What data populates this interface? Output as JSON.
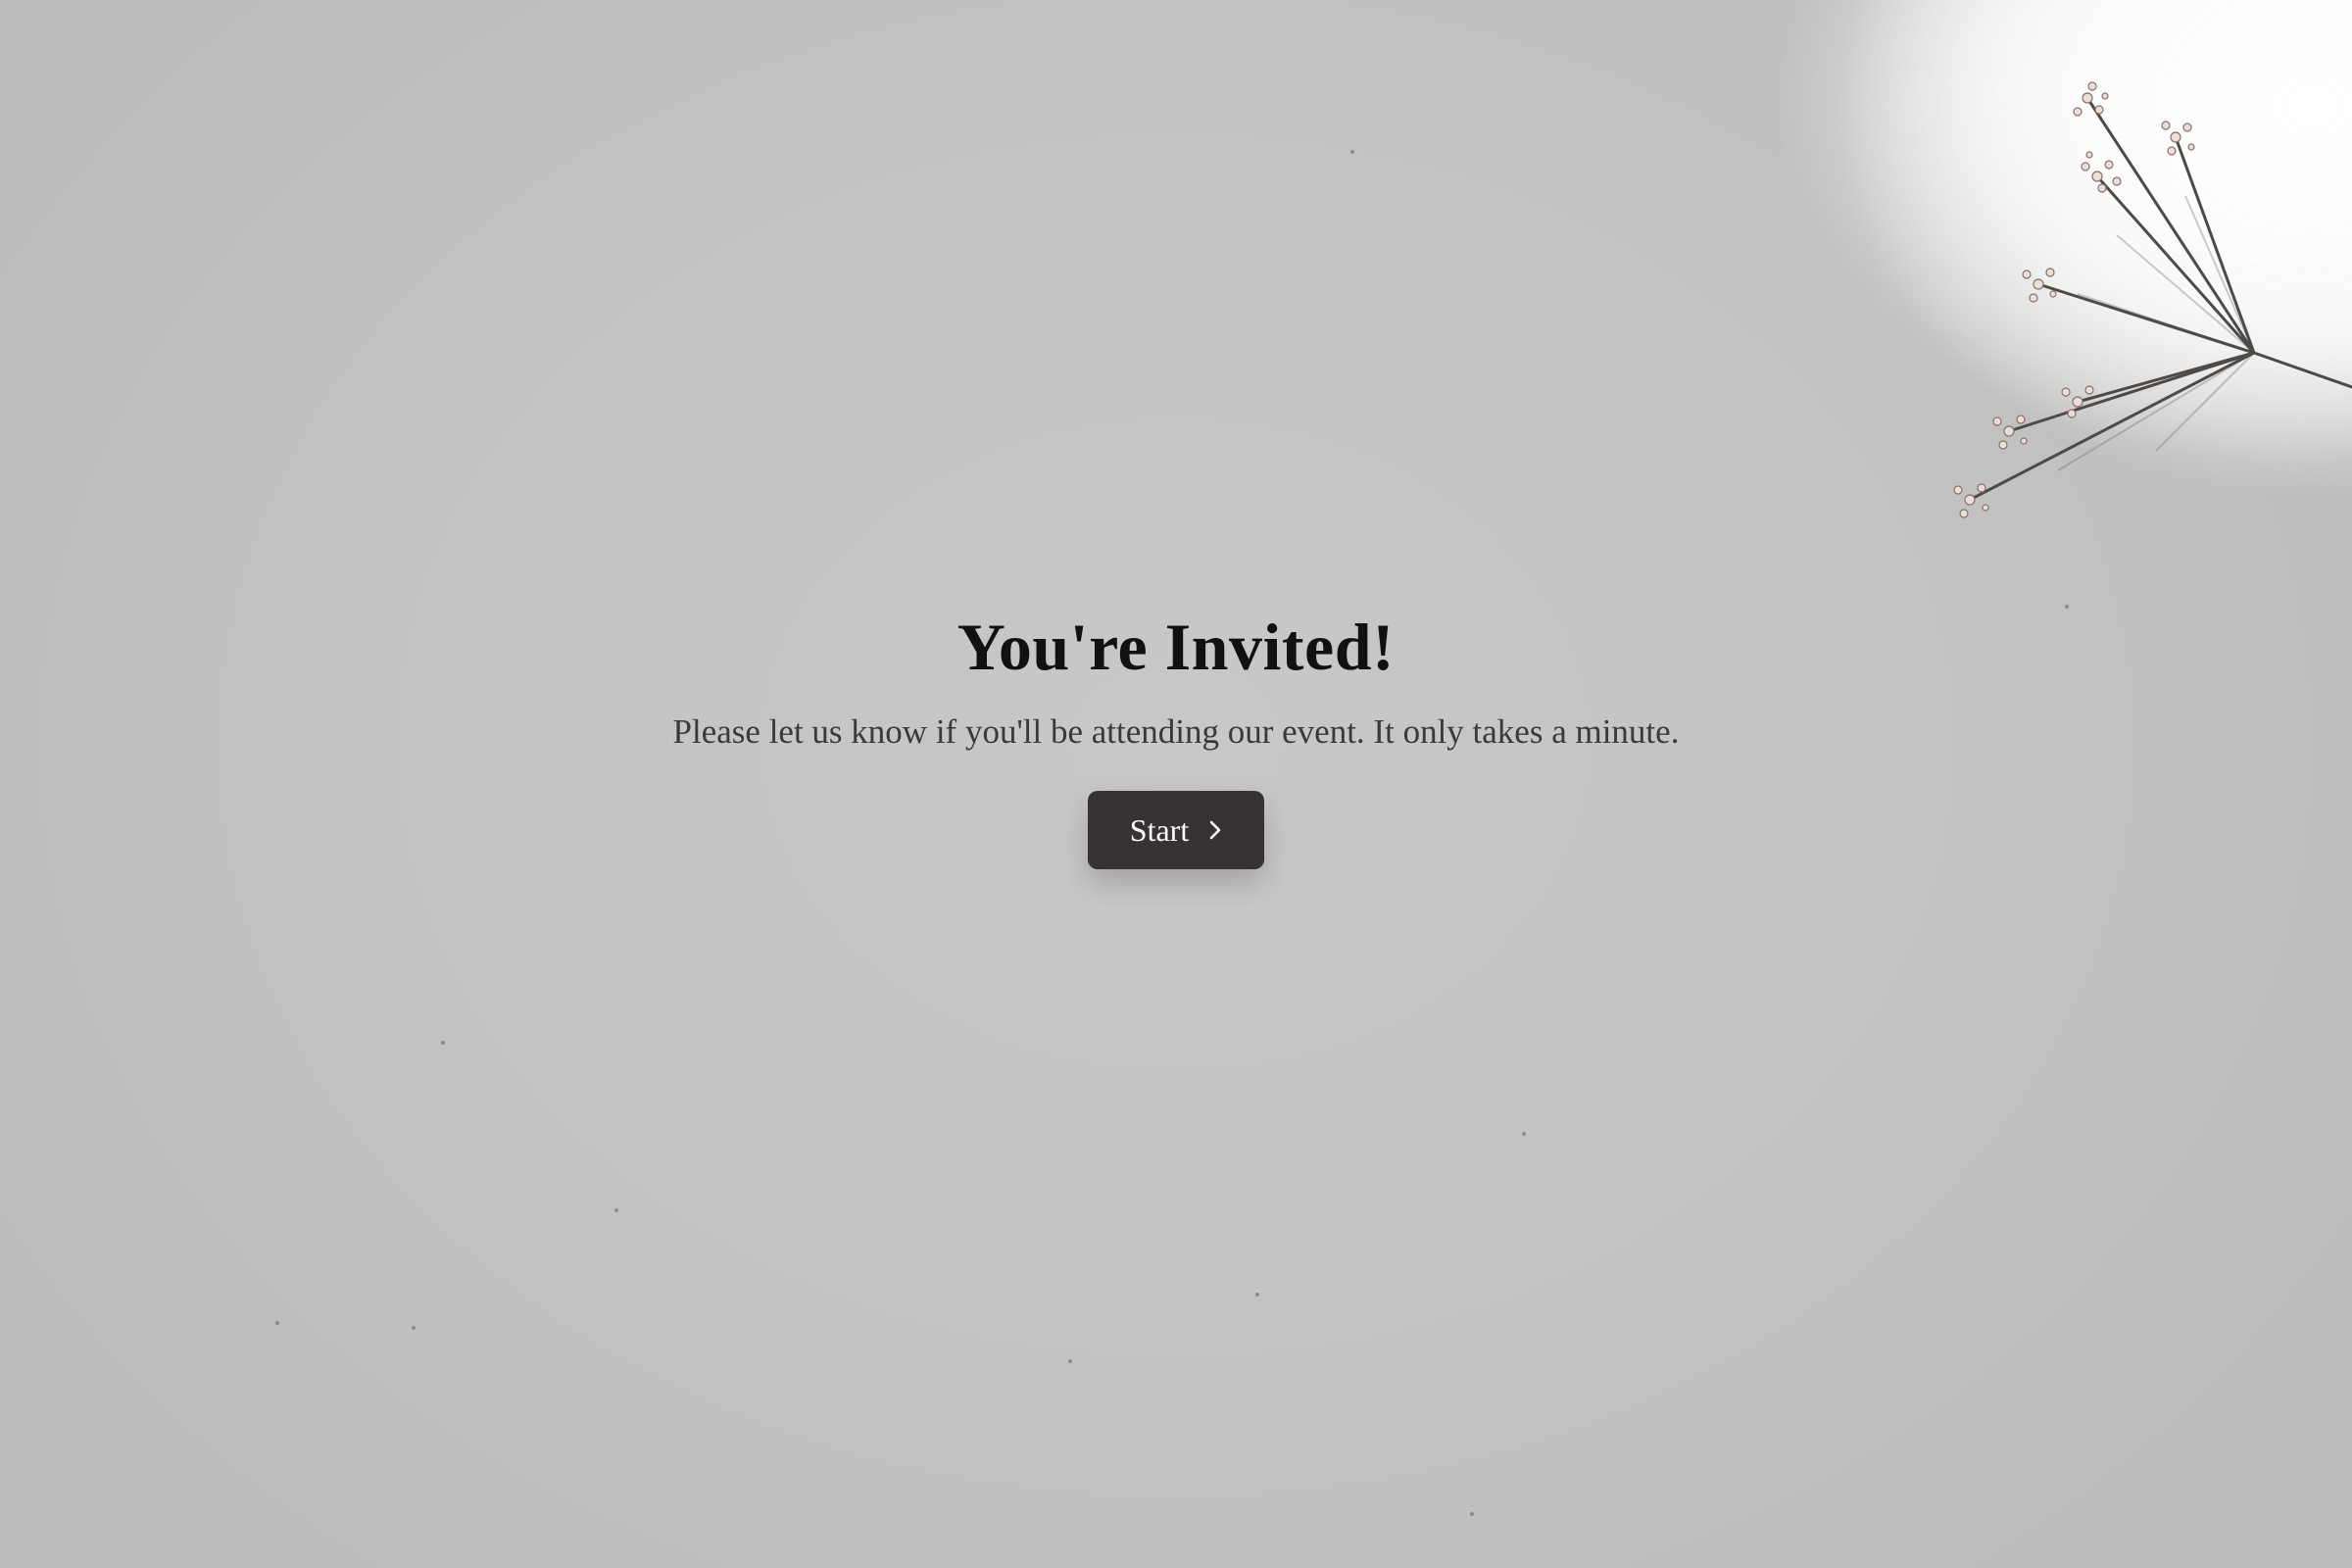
{
  "page": {
    "title": "You're Invited!",
    "subtitle": "Please let us know if you'll be attending our event. It only takes a minute.",
    "start_label": "Start"
  },
  "icons": {
    "start_icon": "chevron-right-icon",
    "decor": "dried-flower-illustration"
  },
  "colors": {
    "background": "#c6c6c6",
    "button": "#363236",
    "button_text": "#ffffff",
    "title": "#111111",
    "subtitle": "#3a3a3a"
  }
}
